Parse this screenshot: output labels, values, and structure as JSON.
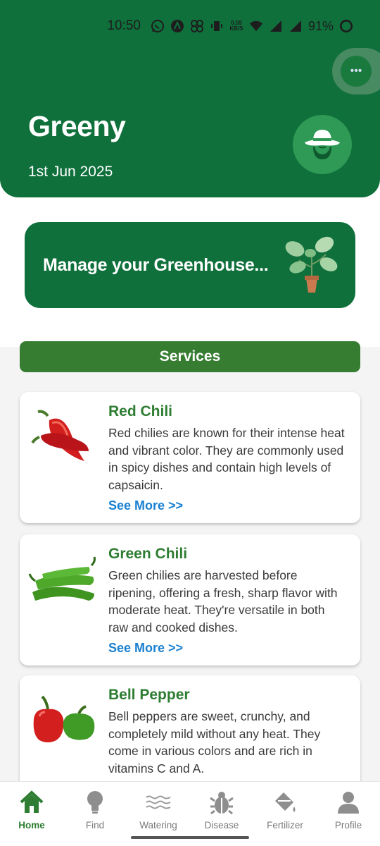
{
  "status_bar": {
    "time": "10:50",
    "net_speed_value": "0.59",
    "net_speed_unit": "KB/S",
    "battery_percent": "91%"
  },
  "header": {
    "title": "Greeny",
    "date": "1st Jun 2025",
    "avatar_icon": "farmer-hat-icon"
  },
  "banner": {
    "text": "Manage your Greenhouse...",
    "icon": "potted-plant-icon"
  },
  "services": {
    "label": "Services",
    "cards": [
      {
        "title": "Red Chili",
        "description": "Red chilies are known for their intense heat and vibrant color. They are commonly used in spicy dishes and contain high levels of capsaicin.",
        "link": "See More >>"
      },
      {
        "title": "Green Chili",
        "description": "Green chilies are harvested before ripening, offering a fresh, sharp flavor with moderate heat. They're versatile in both raw and cooked dishes.",
        "link": "See More >>"
      },
      {
        "title": "Bell Pepper",
        "description": "Bell peppers are sweet, crunchy, and completely mild without any heat. They come in various colors and are rich in vitamins C and A."
      }
    ]
  },
  "nav": {
    "items": [
      {
        "label": "Home",
        "icon": "home-icon",
        "active": true
      },
      {
        "label": "Find",
        "icon": "lightbulb-icon"
      },
      {
        "label": "Watering",
        "icon": "water-waves-icon"
      },
      {
        "label": "Disease",
        "icon": "bug-icon"
      },
      {
        "label": "Fertilizer",
        "icon": "paint-bucket-icon"
      },
      {
        "label": "Profile",
        "icon": "user-icon"
      }
    ]
  },
  "colors": {
    "primary": "#0f703c",
    "accent": "#2e7d32",
    "link": "#1a80d1"
  }
}
